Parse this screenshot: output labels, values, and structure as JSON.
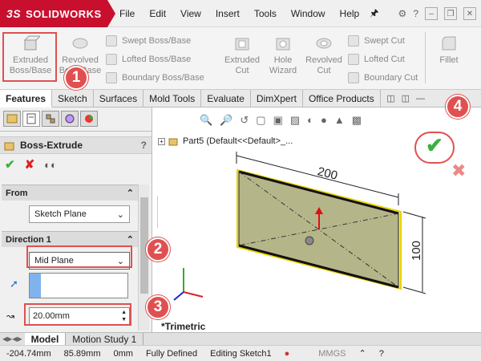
{
  "app": {
    "brand": "SOLIDWORKS",
    "brand_prefix": "3S"
  },
  "menu": [
    "File",
    "Edit",
    "View",
    "Insert",
    "Tools",
    "Window",
    "Help"
  ],
  "ribbon": {
    "extruded_boss": "Extruded Boss/Base",
    "revolved_boss": "Revolved Boss/Base",
    "swept_boss": "Swept Boss/Base",
    "lofted_boss": "Lofted Boss/Base",
    "boundary_boss": "Boundary Boss/Base",
    "extruded_cut": "Extruded Cut",
    "hole_wizard": "Hole Wizard",
    "revolved_cut": "Revolved Cut",
    "swept_cut": "Swept Cut",
    "lofted_cut": "Lofted Cut",
    "boundary_cut": "Boundary Cut",
    "fillet": "Fillet"
  },
  "tabs": [
    "Features",
    "Sketch",
    "Surfaces",
    "Mold Tools",
    "Evaluate",
    "DimXpert",
    "Office Products"
  ],
  "property_manager": {
    "title": "Boss-Extrude",
    "help": "?",
    "from_label": "From",
    "from_value": "Sketch Plane",
    "direction_label": "Direction 1",
    "direction_value": "Mid Plane",
    "depth_value": "20.00mm"
  },
  "tree": {
    "part": "Part5  (Default<<Default>_..."
  },
  "viewport": {
    "dim_width": "200",
    "dim_height": "100",
    "orientation": "*Trimetric"
  },
  "bottom_tabs": [
    "Model",
    "Motion Study 1"
  ],
  "status": {
    "x": "-204.74mm",
    "y": "85.89mm",
    "z": "0mm",
    "state": "Fully Defined",
    "mode": "Editing Sketch1",
    "units": "MMGS"
  },
  "callouts": [
    "1",
    "2",
    "3",
    "4"
  ],
  "colors": {
    "accent": "#c8102e",
    "callout": "#e05050",
    "ok_green": "#3cb043",
    "part_fill": "#b5b58a"
  }
}
